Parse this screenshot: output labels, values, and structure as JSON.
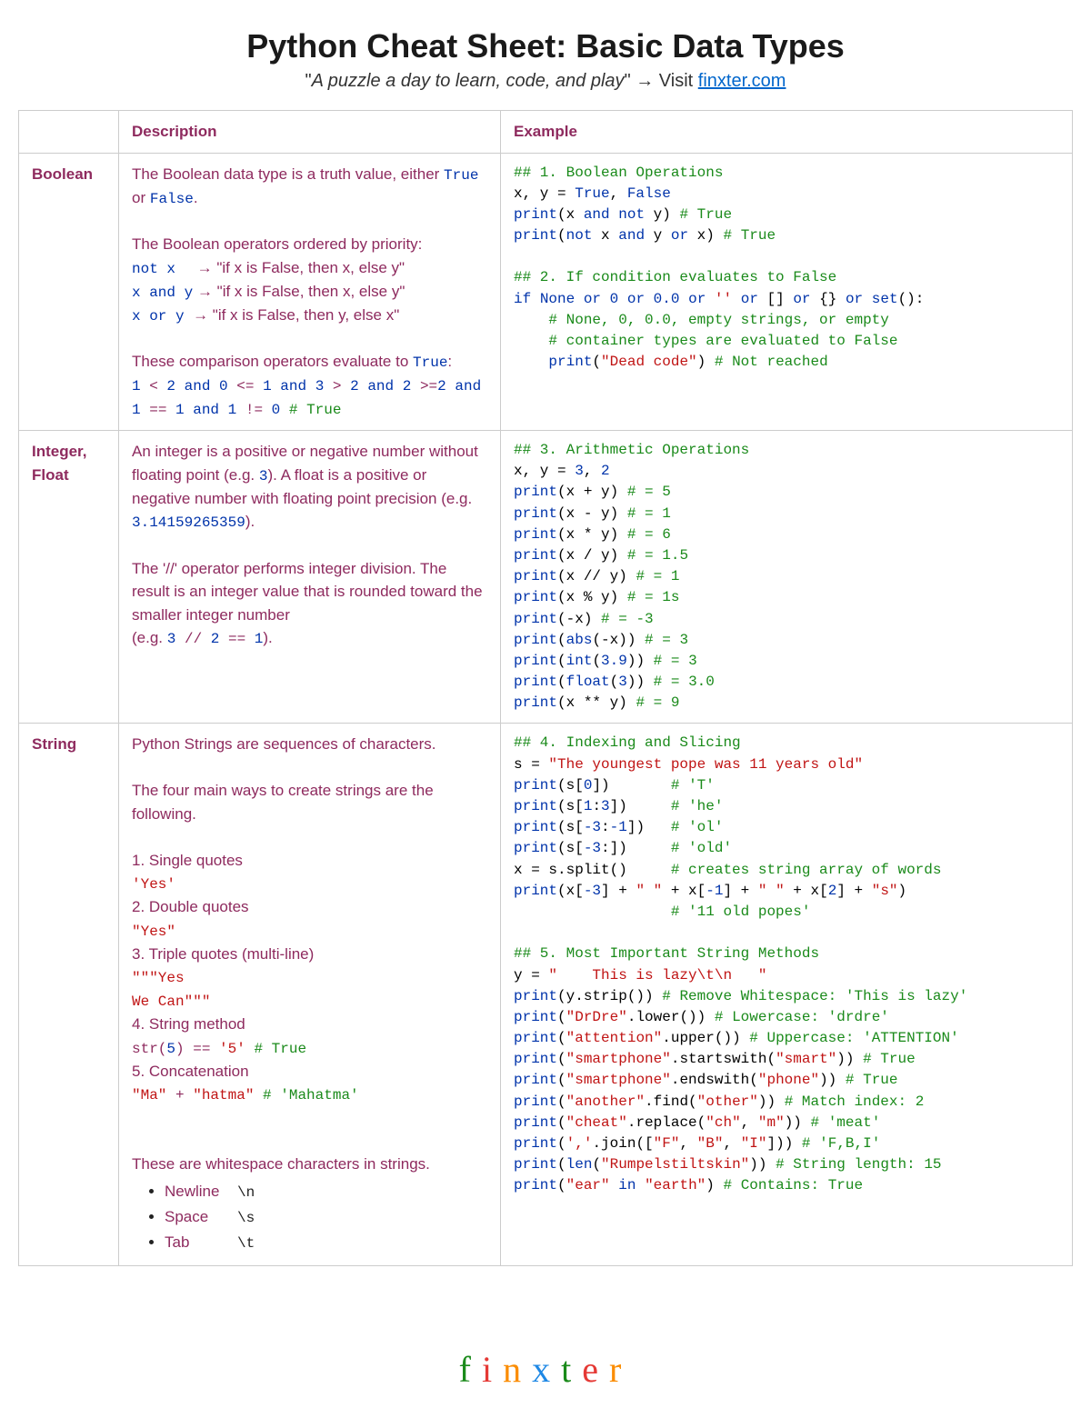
{
  "title": "Python Cheat Sheet: Basic Data Types",
  "subtitle_quote": "A puzzle a day to learn, code, and play",
  "subtitle_visit": " → Visit ",
  "subtitle_link": "finxter.com",
  "headers": {
    "col1": "",
    "col2": "Description",
    "col3": "Example"
  },
  "rows": {
    "boolean": {
      "name": "Boolean",
      "desc_intro": "The Boolean data type is a truth value, either ",
      "true_lit": "True",
      "or_text": " or ",
      "false_lit": "False",
      "period": ".",
      "desc_ops_heading": "The Boolean operators ordered by priority:",
      "op_not_code": "not x",
      "op_not_text": " → \"if x is False, then x, else y\"",
      "op_and_code": "x and y",
      "op_and_text": " → \"if x is False, then x, else y\"",
      "op_or_code": "x or y",
      "op_or_text": " → \"if x is False, then y, else x\"",
      "desc_comp_heading": "These comparison operators evaluate to ",
      "desc_comp_true": "True",
      "desc_comp_colon": ":",
      "comp_expr_l1a": "1",
      "comp_expr_l1b": " < ",
      "comp_expr_l1c": "2",
      "comp_expr_l1d": " and ",
      "comp_expr_l1e": "0",
      "comp_expr_l1f": " <= ",
      "comp_expr_l1g": "1",
      "comp_expr_l1h": " and ",
      "comp_expr_l1i": "3",
      "comp_expr_l1j": " > ",
      "comp_expr_l1k": "2",
      "comp_expr_l1l": " and ",
      "comp_expr_l1m": "2",
      "comp_expr_l1n": " >=",
      "comp_expr_l1o": "2",
      "comp_expr_l1p": " and",
      "comp_expr_l2a": "1",
      "comp_expr_l2b": " == ",
      "comp_expr_l2c": "1",
      "comp_expr_l2d": " and ",
      "comp_expr_l2e": "1",
      "comp_expr_l2f": " != ",
      "comp_expr_l2g": "0",
      "comp_expr_l2h": " # True"
    },
    "intfloat": {
      "name": "Integer, Float",
      "desc_p1a": "An integer is a positive or negative number without floating point (e.g. ",
      "desc_p1b": "3",
      "desc_p1c": "). A float is a positive or negative number with floating point precision (e.g. ",
      "desc_p1d": " 3.14159265359",
      "desc_p1e": ").",
      "desc_p2a": "The '//' operator performs integer division. The result is an integer value that is rounded toward the smaller integer number",
      "desc_p2b": "(e.g. ",
      "desc_p2c": "3",
      "desc_p2d": " // ",
      "desc_p2e": "2",
      "desc_p2f": " == ",
      "desc_p2g": "1",
      "desc_p2h": ")."
    },
    "string": {
      "name": "String",
      "desc_intro": "Python Strings are sequences of characters.",
      "desc_ways": "The four main ways to create strings are the following.",
      "way1_label": "1. Single quotes",
      "way1_code": "'Yes'",
      "way2_label": "2. Double quotes",
      "way2_code": "\"Yes\"",
      "way3_label": "3. Triple quotes (multi-line)",
      "way3_code": "\"\"\"Yes\nWe Can\"\"\"",
      "way4_label": "4. String method",
      "way4_code_a": "str(",
      "way4_code_b": "5",
      "way4_code_c": ") == ",
      "way4_code_d": "'5'",
      "way4_code_e": " # True",
      "way5_label": "5. Concatenation",
      "way5_code_a": "\"Ma\"",
      "way5_code_b": " + ",
      "way5_code_c": "\"hatma\"",
      "way5_code_d": " # 'Mahatma'",
      "ws_heading": "These are whitespace characters in strings.",
      "ws_items": [
        {
          "label": "Newline",
          "code": "\\n"
        },
        {
          "label": "Space",
          "code": "\\s"
        },
        {
          "label": "Tab",
          "code": "\\t"
        }
      ]
    }
  },
  "examples": {
    "boolean": "## 1. Boolean Operations\nx, y = True, False\nprint(x and not y) # True\nprint(not x and y or x) # True\n\n## 2. If condition evaluates to False\nif None or 0 or 0.0 or '' or [] or {} or set():\n    # None, 0, 0.0, empty strings, or empty\n    # container types are evaluated to False\n    print(\"Dead code\") # Not reached",
    "intfloat": "## 3. Arithmetic Operations\nx, y = 3, 2\nprint(x + y) # = 5\nprint(x - y) # = 1\nprint(x * y) # = 6\nprint(x / y) # = 1.5\nprint(x // y) # = 1\nprint(x % y) # = 1s\nprint(-x) # = -3\nprint(abs(-x)) # = 3\nprint(int(3.9)) # = 3\nprint(float(3)) # = 3.0\nprint(x ** y) # = 9",
    "string": "## 4. Indexing and Slicing\ns = \"The youngest pope was 11 years old\"\nprint(s[0])       # 'T'\nprint(s[1:3])     # 'he'\nprint(s[-3:-1])   # 'ol'\nprint(s[-3:])     # 'old'\nx = s.split()     # creates string array of words\nprint(x[-3] + \" \" + x[-1] + \" \" + x[2] + \"s\")\n                  # '11 old popes'\n\n## 5. Most Important String Methods\ny = \"    This is lazy\\t\\n   \"\nprint(y.strip()) # Remove Whitespace: 'This is lazy'\nprint(\"DrDre\".lower()) # Lowercase: 'drdre'\nprint(\"attention\".upper()) # Uppercase: 'ATTENTION'\nprint(\"smartphone\".startswith(\"smart\")) # True\nprint(\"smartphone\".endswith(\"phone\")) # True\nprint(\"another\".find(\"other\")) # Match index: 2\nprint(\"cheat\".replace(\"ch\", \"m\")) # 'meat'\nprint(','.join([\"F\", \"B\", \"I\"])) # 'F,B,I'\nprint(len(\"Rumpelstiltskin\")) # String length: 15\nprint(\"ear\" in \"earth\") # Contains: True"
  },
  "footer_logo": "finxter"
}
